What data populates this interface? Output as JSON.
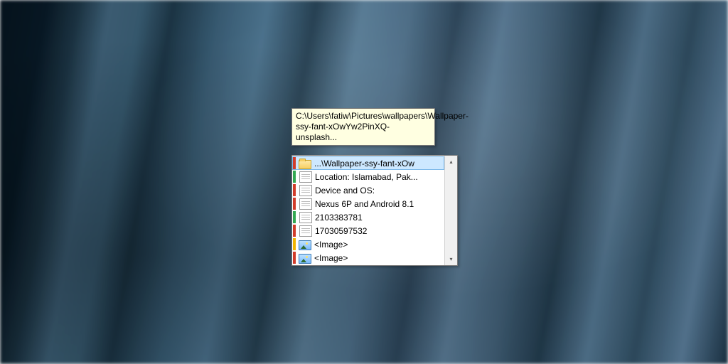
{
  "tooltip": {
    "path": "C:\\Users\\fatiw\\Pictures\\wallpapers\\Wallpaper-ssy-fant-xOwYw2PinXQ-unsplash..."
  },
  "list": {
    "items": [
      {
        "mark": "red",
        "icon": "folder",
        "label": "...\\Wallpaper-ssy-fant-xOw",
        "selected": true
      },
      {
        "mark": "green",
        "icon": "doc",
        "label": "Location: Islamabad, Pak..."
      },
      {
        "mark": "red",
        "icon": "doc",
        "label": "Device and OS:"
      },
      {
        "mark": "red",
        "icon": "doc",
        "label": "Nexus 6P and Android 8.1"
      },
      {
        "mark": "green",
        "icon": "doc",
        "label": "2103383781"
      },
      {
        "mark": "red",
        "icon": "doc",
        "label": "17030597532"
      },
      {
        "mark": "yellow",
        "icon": "image",
        "label": "<Image>"
      },
      {
        "mark": "red",
        "icon": "image",
        "label": "<Image>"
      }
    ]
  },
  "scroll": {
    "up": "▴",
    "down": "▾"
  }
}
